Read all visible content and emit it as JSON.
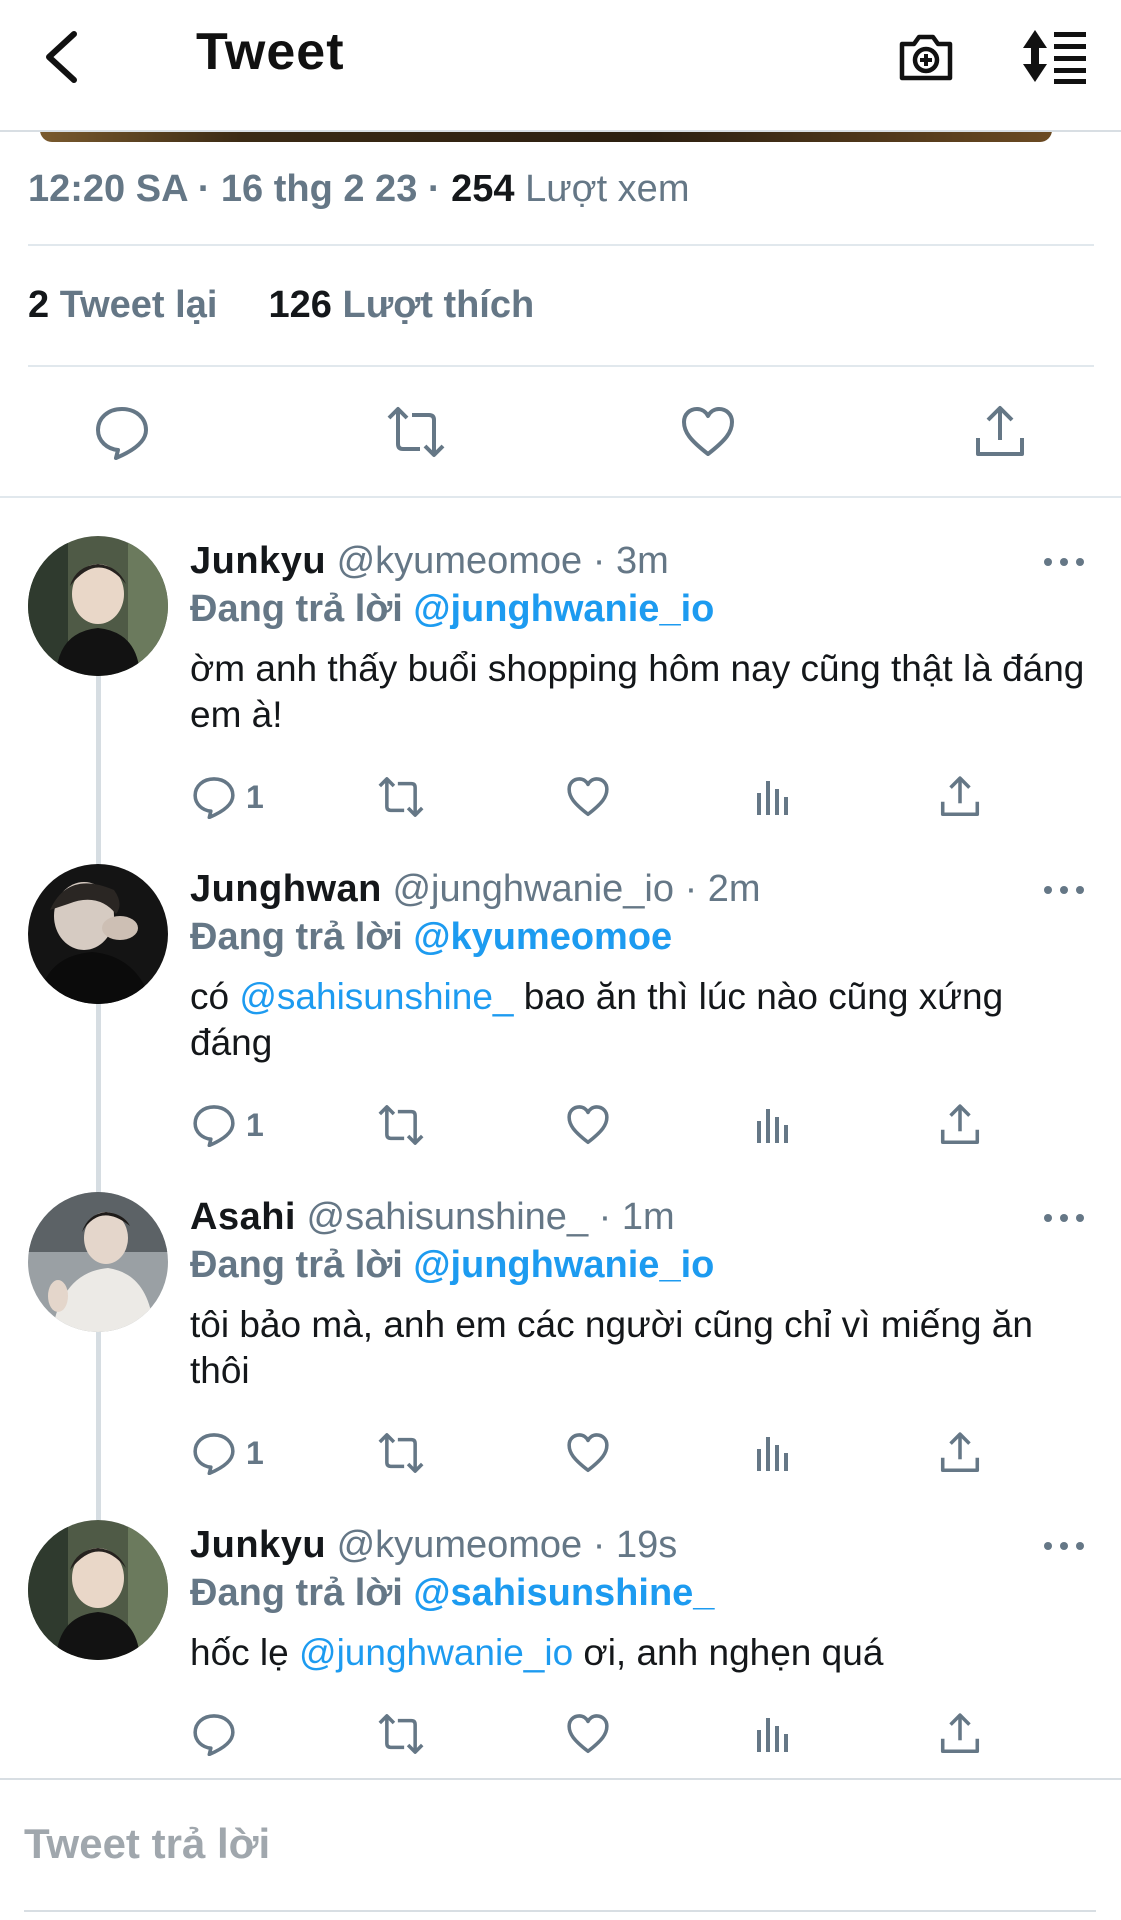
{
  "header": {
    "title": "Tweet",
    "back_icon": "chevron-left-icon",
    "camera_icon": "camera-plus-icon",
    "sort_icon": "sort-list-icon"
  },
  "tweet": {
    "time": "12:20 SA",
    "date": "16 thg 2 23",
    "views_count": "254",
    "views_label": "Lượt xem",
    "retweets_count": "2",
    "retweets_label": "Tweet lại",
    "likes_count": "126",
    "likes_label": "Lượt thích"
  },
  "replies": [
    {
      "name": "Junkyu",
      "handle": "@kyumeomoe",
      "time": "3m",
      "reply_prefix": "Đang trả lời",
      "reply_to": "@junghwanie_io",
      "body_before": "ờm anh thấy buổi shopping hôm nay cũng thật là đáng em à!",
      "body_mention": "",
      "body_after": "",
      "reply_count": "1"
    },
    {
      "name": "Junghwan",
      "handle": "@junghwanie_io",
      "time": "2m",
      "reply_prefix": "Đang trả lời",
      "reply_to": "@kyumeomoe",
      "body_before": "có ",
      "body_mention": "@sahisunshine_",
      "body_after": " bao ăn thì lúc nào cũng xứng đáng",
      "reply_count": "1"
    },
    {
      "name": "Asahi",
      "handle": "@sahisunshine_",
      "time": "1m",
      "reply_prefix": "Đang trả lời",
      "reply_to": "@junghwanie_io",
      "body_before": "tôi bảo mà, anh em các người cũng chỉ vì miếng ăn thôi",
      "body_mention": "",
      "body_after": "",
      "reply_count": "1"
    },
    {
      "name": "Junkyu",
      "handle": "@kyumeomoe",
      "time": "19s",
      "reply_prefix": "Đang trả lời",
      "reply_to": "@sahisunshine_",
      "body_before": "hốc lẹ ",
      "body_mention": "@junghwanie_io",
      "body_after": " ơi, anh nghẹn quá",
      "reply_count": ""
    }
  ],
  "compose": {
    "placeholder": "Tweet trả lời"
  },
  "colors": {
    "accent": "#1d9bf0",
    "muted": "#657786",
    "text": "#14171a"
  }
}
